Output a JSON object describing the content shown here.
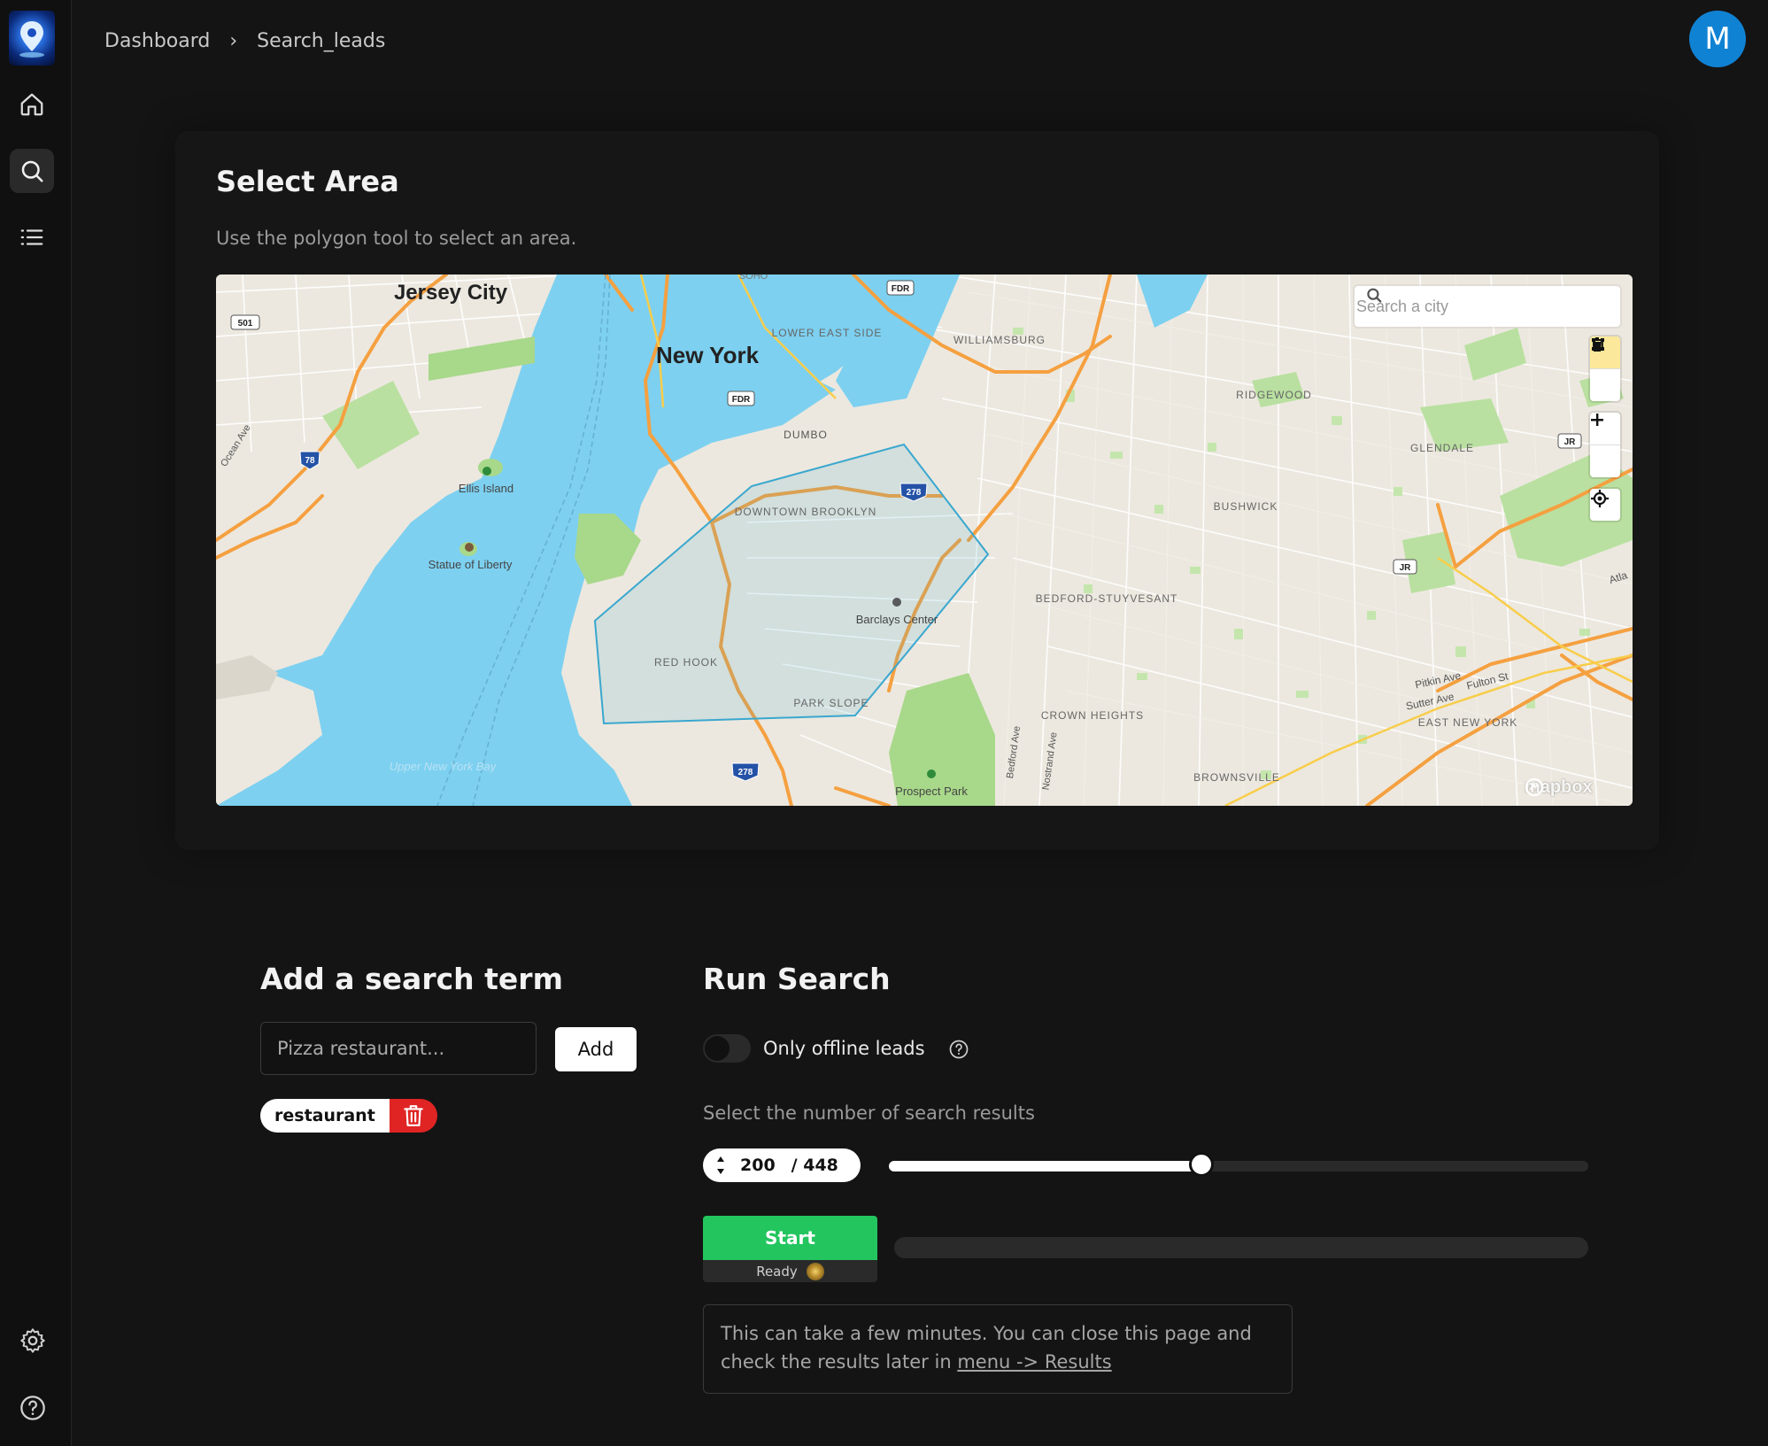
{
  "app": {
    "logo_icon": "map-pin-logo-icon"
  },
  "breadcrumb": {
    "items": [
      "Dashboard",
      "Search_leads"
    ],
    "separator": "›"
  },
  "user": {
    "avatar_initial": "M",
    "avatar_color": "#1082d3"
  },
  "sidebar": {
    "nav": [
      {
        "name": "home",
        "icon": "home-icon",
        "active": false
      },
      {
        "name": "search",
        "icon": "search-icon",
        "active": true
      },
      {
        "name": "results",
        "icon": "list-icon",
        "active": false
      }
    ],
    "bottom": [
      {
        "name": "settings",
        "icon": "gear-icon"
      },
      {
        "name": "help",
        "icon": "help-icon"
      }
    ]
  },
  "select_area": {
    "title": "Select Area",
    "subtitle": "Use the polygon tool to select an area.",
    "map": {
      "search_placeholder": "Search a city",
      "attribution": "mapbox",
      "labels": {
        "jersey_city": "Jersey City",
        "new_york": "New York",
        "lower_east_side": "LOWER EAST SIDE",
        "williamsburg": "WILLIAMSBURG",
        "ridgewood": "RIDGEWOOD",
        "glendale": "GLENDALE",
        "dumbo": "DUMBO",
        "downtown_brooklyn": "DOWNTOWN BROOKLYN",
        "bushwick": "BUSHWICK",
        "bedford_stuyvesant": "BEDFORD-STUYVESANT",
        "ellis_island": "Ellis Island",
        "statue_of_liberty": "Statue of Liberty",
        "barclays_center": "Barclays Center",
        "red_hook": "RED HOOK",
        "park_slope": "PARK SLOPE",
        "crown_heights": "CROWN HEIGHTS",
        "east_new_york": "EAST NEW YORK",
        "brownsville": "BROWNSVILLE",
        "prospect_park": "Prospect Park",
        "upper_new_york_bay": "Upper New York Bay",
        "ocean_ave": "Ocean Ave",
        "bedford_ave": "Bedford Ave",
        "nostrand_ave": "Nostrand Ave",
        "fulton_st": "Fulton St",
        "pitkin_ave": "Pitkin Ave",
        "sutter_ave": "Sutter Ave",
        "atlantic": "Atla",
        "soho": "SOHO",
        "shield_501": "501",
        "shield_78": "78",
        "shield_278": "278",
        "shield_fdr": "FDR",
        "shield_jr": "JR"
      },
      "colors": {
        "water": "#7dd0f0",
        "land": "#ece8df",
        "park": "#a8d88a",
        "highway": "#f5a040",
        "polygon": "#3aa7cf"
      }
    }
  },
  "search_term": {
    "title": "Add a search term",
    "input_placeholder": "Pizza restaurant...",
    "input_value": "",
    "add_label": "Add",
    "tags": [
      "restaurant"
    ]
  },
  "run_search": {
    "title": "Run Search",
    "offline_toggle_label": "Only offline leads",
    "offline_toggle_on": false,
    "results_label": "Select the number of search results",
    "results_count": "200",
    "results_total": "/ 448",
    "slider_fraction": 0.4464,
    "start_label": "Start",
    "status_label": "Ready",
    "progress_fraction": 0,
    "info_text": "This can take a few minutes. You can close this page and check the results later in ",
    "info_link": "menu -> Results",
    "colors": {
      "start": "#22c55e",
      "track": "#2a2a2a"
    }
  }
}
